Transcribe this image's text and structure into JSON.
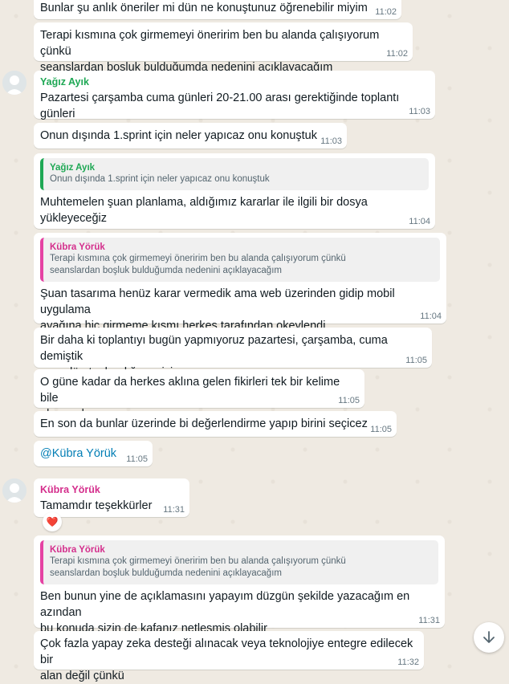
{
  "messages": {
    "m1": {
      "text": "Bunlar şu anlık öneriler mi dün ne konuştunuz öğrenebilir miyim",
      "time": "11:02"
    },
    "m2": {
      "text": "Terapi kısmına çok girmemeyi öneririm ben bu alanda çalışıyorum çünkü\nseanslardan boşluk bulduğumda nedenini açıklayacağım",
      "time": "11:02"
    },
    "m3": {
      "sender": "Yağız Ayık",
      "text": "Pazartesi çarşamba cuma günleri 20-21.00 arası gerektiğinde toplantı günleri",
      "time": "11:03"
    },
    "m4": {
      "text": "Onun dışında 1.sprint için neler yapıcaz onu konuştuk",
      "time": "11:03"
    },
    "m5": {
      "quote_sender": "Yağız Ayık",
      "quote_text": "Onun dışında 1.sprint için neler yapıcaz onu konuştuk",
      "text": "Muhtemelen şuan planlama, aldığımız kararlar ile ilgili bir dosya yükleyeceğiz",
      "time": "11:04"
    },
    "m6": {
      "quote_sender": "Kübra Yörük",
      "quote_text": "Terapi kısmına çok girmemeyi öneririm ben bu alanda çalışıyorum çünkü\nseanslardan boşluk bulduğumda nedenini açıklayacağım",
      "text": "Şuan tasarıma henüz karar vermedik ama web üzerinden gidip mobil uygulama\nayağına hiç girmeme kısmı herkes tarafından okeylendi",
      "time": "11:04"
    },
    "m7": {
      "text": "Bir daha ki toplantıyı bugün yapmıyoruz pazartesi, çarşamba, cuma demiştik\nama dün toplandığımız için cuma yapıcaz",
      "time": "11:05"
    },
    "m8": {
      "text": "O güne kadar da herkes aklına gelen fikirleri tek bir kelime bile\nolsa gruba yazıyo",
      "time": "11:05"
    },
    "m9": {
      "text": "En son da bunlar üzerinde bi değerlendirme yapıp birini seçicez",
      "time": "11:05"
    },
    "m10": {
      "text": "@Kübra Yörük",
      "time": "11:05"
    },
    "m11": {
      "sender": "Kübra Yörük",
      "text": "Tamamdır teşekkürler",
      "time": "11:31",
      "reaction": "❤️"
    },
    "m12": {
      "quote_sender": "Kübra Yörük",
      "quote_text": "Terapi kısmına çok girmemeyi öneririm ben bu alanda çalışıyorum çünkü\nseanslardan boşluk bulduğumda nedenini açıklayacağım",
      "text": "Ben bunun yine de açıklamasını yapayım düzgün şekilde yazacağım en azından\nbu konuda sizin de kafanız netlesmis olabilir",
      "time": "11:31"
    },
    "m13": {
      "text": "Çok fazla yapay zeka desteği alınacak veya teknolojiye entegre edilecek bir\nalan değil çünkü",
      "time": "11:32"
    }
  },
  "icons": {
    "scroll_down": "arrow-down-icon",
    "avatar": "default-avatar-icon",
    "reaction": "heart-icon"
  },
  "colors": {
    "chat_bg": "#efeae2",
    "bubble": "#ffffff",
    "sender_green": "#1fa855",
    "sender_pink": "#d42e8c",
    "mention": "#027eb5"
  }
}
